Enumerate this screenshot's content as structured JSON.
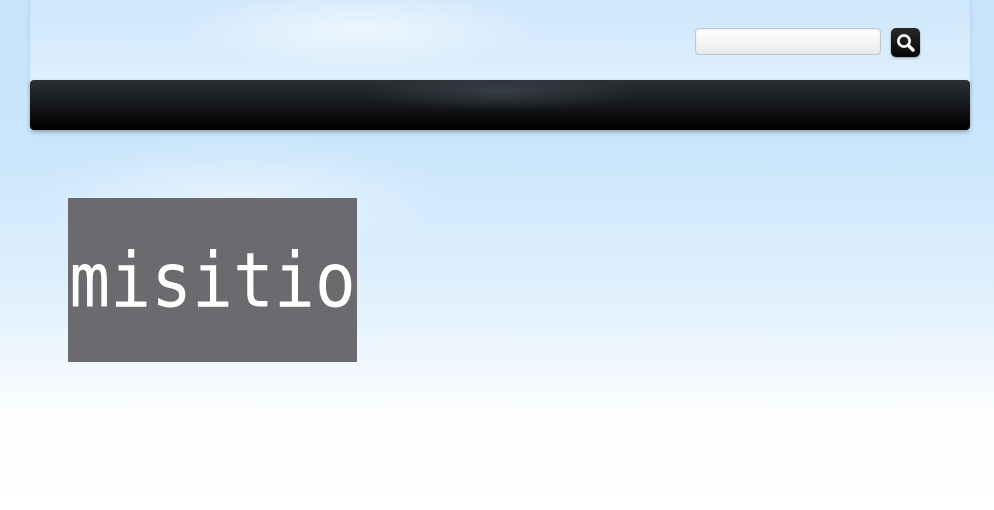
{
  "header": {
    "search": {
      "placeholder": "",
      "value": "",
      "button_icon": "search-icon"
    }
  },
  "navbar": {
    "items": []
  },
  "logo": {
    "text": "misitio"
  },
  "colors": {
    "navbar": "#0c0d0f",
    "logo_background": "#6b6a6f",
    "logo_text": "#ffffff",
    "page_top": "#c8e4fb",
    "page_bottom": "#ffffff"
  }
}
